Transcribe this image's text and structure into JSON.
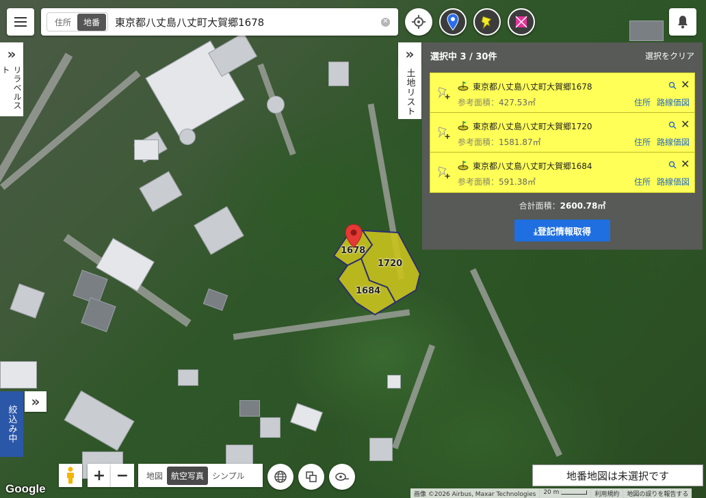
{
  "search": {
    "mode_address": "住所",
    "mode_lot": "地番",
    "query": "東京都八丈島八丈町大賀郷1678"
  },
  "side": {
    "label_list": "リラベルスト",
    "land_list": "土地リスト",
    "filter": "絞込み中"
  },
  "panel": {
    "count_text": "選択中 3 / 30件",
    "clear_text": "選択をクリア",
    "items": [
      {
        "address": "東京都八丈島八丈町大賀郷1678",
        "area_label": "参考面積：",
        "area_value": "427.53㎡",
        "link_address": "住所",
        "link_price": "路線価図"
      },
      {
        "address": "東京都八丈島八丈町大賀郷1720",
        "area_label": "参考面積：",
        "area_value": "1581.87㎡",
        "link_address": "住所",
        "link_price": "路線価図"
      },
      {
        "address": "東京都八丈島八丈町大賀郷1684",
        "area_label": "参考面積：",
        "area_value": "591.38㎡",
        "link_address": "住所",
        "link_price": "路線価図"
      }
    ],
    "total_label": "合計面積：",
    "total_value": "2600.78㎡",
    "register_button": "⤓登記情報取得"
  },
  "map": {
    "parcels": [
      "1678",
      "1720",
      "1684"
    ],
    "parcel_color": "#c9c21e"
  },
  "bottom": {
    "type_map": "地図",
    "type_aerial": "航空写真",
    "type_simple": "シンプル",
    "google": "Google",
    "status": "地番地図は未選択です",
    "attribution": "画像 ©2026 Airbus, Maxar Technologies",
    "scale": "20 m",
    "terms": "利用規約",
    "report": "地図の誤りを報告する"
  },
  "colors": {
    "accent_blue": "#1f6fe0",
    "list_yellow": "#ffff57",
    "pin_red": "#e53935"
  }
}
